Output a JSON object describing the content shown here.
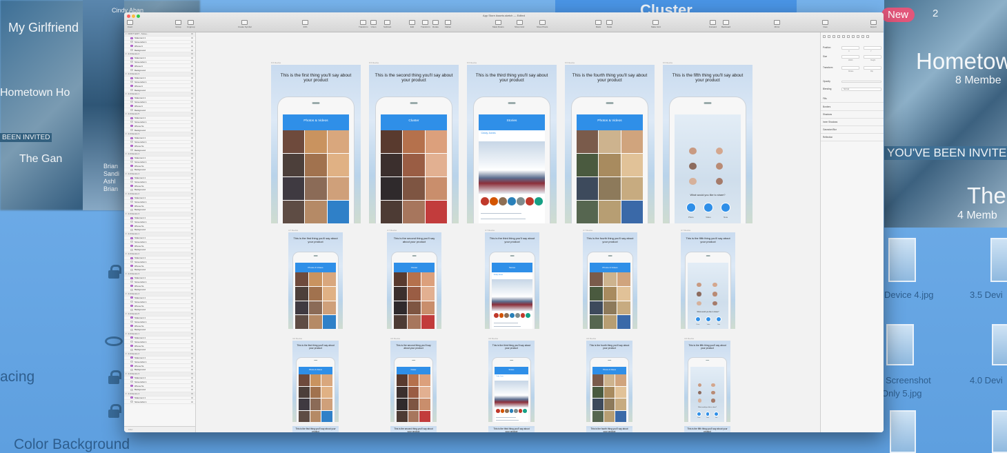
{
  "background": {
    "left_texts": [
      "My Girlfriend",
      "Hometown Ho",
      "BEEN INVITED",
      "The Gan"
    ],
    "left_user": "Cindy Aban",
    "left_brief": [
      "Brian",
      "Sandi",
      "Ashl",
      "Brian"
    ],
    "left_labels": [
      "acing",
      "Color Background"
    ],
    "topbar_brand": "Cluster",
    "right_new": "New",
    "right_count": "2",
    "right_title": "Hometow",
    "right_members": "8 Membe",
    "right_invited": "YOU'VE BEEN INVITED",
    "right_the": "The",
    "right_members2": "4 Memb",
    "right_files": [
      "Device 4.jpg",
      "3.5 Devi",
      "Screenshot",
      "Only 5.jpg",
      "4.0 Devi"
    ]
  },
  "window": {
    "title": "App Store Assets.sketch — Edited",
    "toolbar": [
      {
        "label": "Insert"
      },
      {
        "label": "Group"
      },
      {
        "label": "Ungroup"
      },
      {
        "label": "Create Symbol"
      },
      {
        "label": "33%"
      },
      {
        "label": "Transform"
      },
      {
        "label": "Union"
      },
      {
        "label": "Subtract"
      },
      {
        "label": "Edit"
      },
      {
        "label": "Transform"
      },
      {
        "label": "Rotate"
      },
      {
        "label": "Flatten"
      },
      {
        "label": "Mask Rulers"
      },
      {
        "label": "Show Grid"
      },
      {
        "label": "Show Pixels"
      },
      {
        "label": "Mask"
      },
      {
        "label": "Scale"
      },
      {
        "label": "Make Grid"
      },
      {
        "label": "Forward"
      },
      {
        "label": "Backward"
      },
      {
        "label": "Mirror"
      },
      {
        "label": "View"
      },
      {
        "label": "Export"
      }
    ]
  },
  "layers": {
    "rows": [
      {
        "label": "DON'T EDIT - Scree...",
        "type": "group"
      },
      {
        "label": "Statement 1",
        "type": "folder"
      },
      {
        "label": "Screenshot 1",
        "type": "layer"
      },
      {
        "label": "iPhone 6",
        "type": "folder"
      },
      {
        "label": "Background",
        "type": "layer"
      },
      {
        "label": "4.0 Device 2",
        "type": "group"
      },
      {
        "label": "Statement 1",
        "type": "folder"
      },
      {
        "label": "Screenshot 1",
        "type": "layer"
      },
      {
        "label": "iPhone 6",
        "type": "folder"
      },
      {
        "label": "Background",
        "type": "layer"
      },
      {
        "label": "4.0 Device 3",
        "type": "group"
      },
      {
        "label": "Statement 1",
        "type": "folder"
      },
      {
        "label": "Screenshot 1",
        "type": "layer"
      },
      {
        "label": "iPhone 6",
        "type": "folder"
      },
      {
        "label": "Background",
        "type": "layer"
      },
      {
        "label": "4.0 Device 1",
        "type": "group"
      },
      {
        "label": "Statement 1",
        "type": "folder"
      },
      {
        "label": "Screenshot 1",
        "type": "layer"
      },
      {
        "label": "iPhone 6",
        "type": "folder"
      },
      {
        "label": "Background",
        "type": "layer"
      },
      {
        "label": "4.0 Device 5",
        "type": "group"
      },
      {
        "label": "Statement 1",
        "type": "folder"
      },
      {
        "label": "Screenshot 1",
        "type": "layer"
      },
      {
        "label": "iPhone 5s",
        "type": "folder"
      },
      {
        "label": "Background",
        "type": "layer"
      },
      {
        "label": "4.0 Device 3",
        "type": "group"
      },
      {
        "label": "Statement 1",
        "type": "folder"
      },
      {
        "label": "Screenshot 1",
        "type": "layer"
      },
      {
        "label": "iPhone 5s",
        "type": "folder"
      },
      {
        "label": "Background",
        "type": "layer"
      },
      {
        "label": "4.0 Device 4",
        "type": "group"
      },
      {
        "label": "Statement 1",
        "type": "folder"
      },
      {
        "label": "Screenshot 1",
        "type": "layer"
      },
      {
        "label": "iPhone 5s",
        "type": "folder"
      },
      {
        "label": "Background",
        "type": "layer"
      },
      {
        "label": "4.0 Device 4",
        "type": "group"
      },
      {
        "label": "Statement 1",
        "type": "folder"
      },
      {
        "label": "Screenshot 1",
        "type": "layer"
      },
      {
        "label": "iPhone 5s",
        "type": "folder"
      },
      {
        "label": "Background",
        "type": "layer"
      },
      {
        "label": "4.0 Device 2",
        "type": "group"
      },
      {
        "label": "Statement 1",
        "type": "folder"
      },
      {
        "label": "Screenshot 1",
        "type": "layer"
      },
      {
        "label": "iPhone 5s",
        "type": "folder"
      },
      {
        "label": "Background",
        "type": "layer"
      },
      {
        "label": "4.0 Device 3",
        "type": "group"
      },
      {
        "label": "Statement 1",
        "type": "folder"
      },
      {
        "label": "Screenshot 1",
        "type": "layer"
      },
      {
        "label": "iPhone 5s",
        "type": "folder"
      },
      {
        "label": "Background",
        "type": "layer"
      },
      {
        "label": "4.0 Device 1",
        "type": "group"
      },
      {
        "label": "Statement 1",
        "type": "folder"
      },
      {
        "label": "Screenshot 1",
        "type": "layer"
      },
      {
        "label": "iPhone 5s",
        "type": "folder"
      },
      {
        "label": "Background",
        "type": "layer"
      },
      {
        "label": "4.0 Device 2",
        "type": "group"
      },
      {
        "label": "Statement 1",
        "type": "folder"
      },
      {
        "label": "Screenshot 1",
        "type": "layer"
      },
      {
        "label": "iPhone 5s",
        "type": "folder"
      },
      {
        "label": "Background",
        "type": "layer"
      },
      {
        "label": "4.0 Device 3",
        "type": "group"
      },
      {
        "label": "Statement 1",
        "type": "folder"
      },
      {
        "label": "Screenshot 1",
        "type": "layer"
      },
      {
        "label": "iPhone 5s",
        "type": "folder"
      },
      {
        "label": "Background",
        "type": "layer"
      },
      {
        "label": "4.0 Device 4",
        "type": "group"
      },
      {
        "label": "Statement 1",
        "type": "folder"
      },
      {
        "label": "Screenshot 1",
        "type": "layer"
      },
      {
        "label": "iPhone 5s",
        "type": "folder"
      },
      {
        "label": "Background",
        "type": "layer"
      },
      {
        "label": "4.0 Device 5",
        "type": "group"
      },
      {
        "label": "Statement 1",
        "type": "folder"
      },
      {
        "label": "Screenshot 1",
        "type": "layer"
      },
      {
        "label": "iPhone 5s",
        "type": "folder"
      },
      {
        "label": "Background",
        "type": "layer"
      },
      {
        "label": "4.0 Device 1",
        "type": "group"
      },
      {
        "label": "Statement 1",
        "type": "folder"
      },
      {
        "label": "Screenshot 1",
        "type": "layer"
      },
      {
        "label": "iPhone 5s",
        "type": "folder"
      },
      {
        "label": "Background",
        "type": "layer"
      },
      {
        "label": "4.0 Device 2",
        "type": "group"
      },
      {
        "label": "Statement 1",
        "type": "folder"
      },
      {
        "label": "Screenshot 1",
        "type": "layer"
      },
      {
        "label": "iPhone 5s",
        "type": "folder"
      },
      {
        "label": "Background",
        "type": "layer"
      },
      {
        "label": "4.0 Device 3",
        "type": "group"
      },
      {
        "label": "Statement 1",
        "type": "folder"
      },
      {
        "label": "Screenshot 1",
        "type": "layer"
      },
      {
        "label": "iPhone 5s",
        "type": "folder"
      },
      {
        "label": "Background",
        "type": "layer"
      },
      {
        "label": "4.0 Device 4",
        "type": "group"
      },
      {
        "label": "Statement 1",
        "type": "folder"
      },
      {
        "label": "Screenshot 1",
        "type": "layer"
      }
    ],
    "filter_placeholder": "Filter"
  },
  "inspector": {
    "labels": [
      "Position",
      "Size",
      "Transform",
      "Opacity",
      "Blending",
      "Fills",
      "Borders",
      "Shadows",
      "Inner Shadows",
      "Gaussian Blur",
      "Reflection"
    ],
    "sub_labels": [
      "X",
      "Y",
      "Width",
      "Height",
      "Rotate",
      "Flip"
    ],
    "blending_value": "Normal"
  },
  "artboards": {
    "statements": [
      "This is the first thing you'll say about your product",
      "This is the second thing you'll say about your product",
      "This is the third thing you'll say about your product",
      "This is the fourth thing you'll say about your product",
      "This is the fifth thing you'll say about your product"
    ],
    "row_labels": [
      "6.5 Device",
      "4.7 Device",
      "4.0 Device"
    ],
    "app_names": [
      "Photos & Videos",
      "Cluster",
      "Stories",
      "Photos & Videos",
      ""
    ],
    "share_prompt": "What would you like to share?",
    "share_buttons": [
      "Photo",
      "Video",
      "Note"
    ],
    "post_author": "Cindy Jones"
  },
  "colors": {
    "accent": "#2f8fe8",
    "window_bg": "#f2f2f2"
  }
}
